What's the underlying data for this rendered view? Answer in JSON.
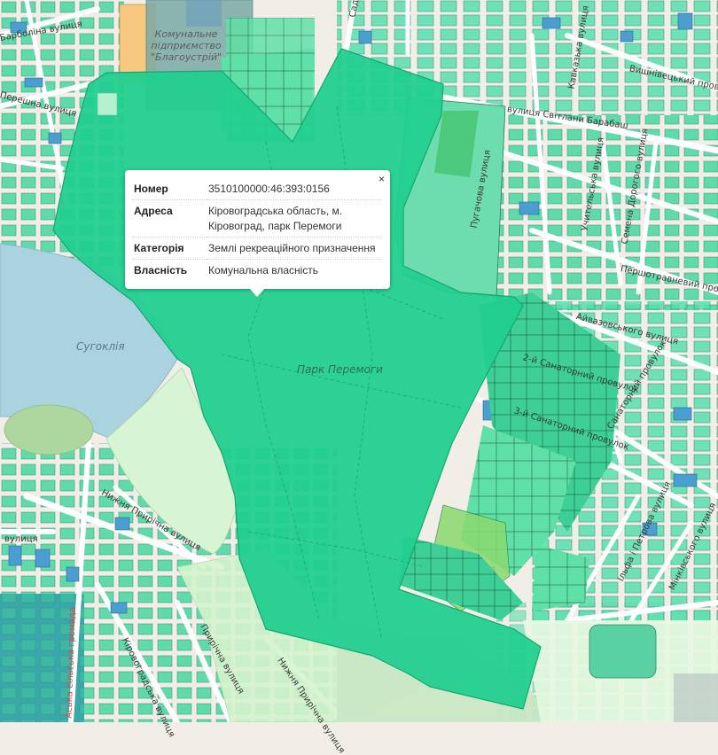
{
  "popup": {
    "close": "×",
    "rows": [
      {
        "key": "Номер",
        "value": "3510100000:46:393:0156"
      },
      {
        "key": "Адреса",
        "value": "Кіровоградська область, м. Кіровоград, парк Перемоги"
      },
      {
        "key": "Категорія",
        "value": "Землі рекреаційного призначення"
      },
      {
        "key": "Власність",
        "value": "Комунальна власність"
      }
    ]
  },
  "map": {
    "labels": {
      "poi_line1": "Комунальне",
      "poi_line2": "підприємство",
      "poi_line3": "\"Благоустрій\"",
      "lake": "Сугоклія",
      "park": "Парк Перемоги",
      "barbolina": "Барболіна вулиця",
      "pereshna": "Перешна вулиця",
      "kavkazka": "Кавказька вулиця",
      "vyshnivetska": "Вишнівецький провулок",
      "barabash": "вулиця Світлани Барабаш",
      "pugachova": "Пугачова вулиця",
      "sadova": "Садова",
      "buchelna": "Учительська вулиця",
      "dorogoho": "Семена Дорогого вулиця",
      "pershotravneva": "Першотравневий провулок",
      "aivazovskoho": "Айвазовського вулиця",
      "sanatorny2": "2-й Санаторний провулок",
      "sanatorny3": "3-й Санаторний провулок",
      "sanatorny": "Санаторний провулок",
      "petrova": "Ільфа і Петрова вулиця",
      "minkovskoho": "Мінківського вулиця",
      "nyzhnia_prirechna": "Нижня Прирічна вулиця",
      "prirechna": "Прирічна вулиця",
      "kirovohradska": "Кіровоградська вулиця",
      "nyzhnia_prirechna2": "Нижня Прирічна вулиця",
      "vulytsia": "вулиця",
      "hromada": "Аська сільська громада"
    },
    "colors": {
      "background": "#f1eee8",
      "parcel_fill": "#47d6a0",
      "parcel_blue": "#4a9fd0",
      "highlight": "#22cf8f",
      "water": "#aad3df",
      "park_green": "#c8facc",
      "road": "#ffffff"
    }
  }
}
